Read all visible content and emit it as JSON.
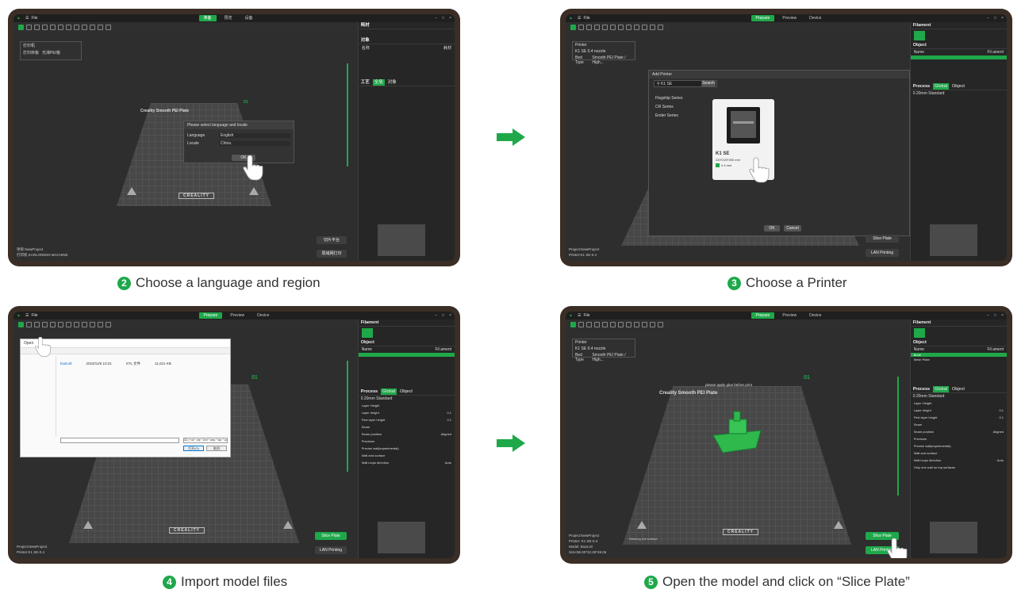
{
  "captions": {
    "step2": {
      "num": "2",
      "text": "Choose a language and region"
    },
    "step3": {
      "num": "3",
      "text": "Choose a Printer"
    },
    "step4": {
      "num": "4",
      "text": "Import model files"
    },
    "step5": {
      "num": "5",
      "text": "Open the model and click on “Slice Plate”"
    }
  },
  "colors": {
    "accent": "#1fa84a",
    "frame": "#3a2e26",
    "app_bg": "#2b2b2b"
  },
  "app": {
    "menu_file": "File",
    "tabs_en": [
      "Prepare",
      "Preview",
      "Device"
    ],
    "tabs_zh": [
      "准备",
      "预览",
      "设备"
    ],
    "plate_name": "Creality Smooth PEI Plate",
    "plate_warning": "please apply glue before print",
    "plate_number": "01",
    "brand": "CREALITY",
    "warning_surface": "Warning hot surface",
    "slice_plate": "Slice Plate",
    "lan_printing": "LAN Printing",
    "slice_zh": "切片平台",
    "lan_zh": "局域网打印"
  },
  "sidebar_en": {
    "filament": "Filament",
    "object": "Object",
    "process": "Process",
    "global": "Global",
    "object_tab": "Object",
    "preset": "0.20mm Standard",
    "col_name": "Name",
    "col_fil": "Fil ament",
    "model_item": "Bunk",
    "mesh_plate": "Mesh Plate",
    "rows": [
      {
        "label": "Layer Height",
        "value": ""
      },
      {
        "label": "Layer height",
        "value": "0.1"
      },
      {
        "label": "First layer height",
        "value": "0.1"
      },
      {
        "label": "Seam",
        "value": ""
      },
      {
        "label": "Seam position",
        "value": "Aligned"
      },
      {
        "label": "Precision",
        "value": ""
      },
      {
        "label": "Precise wall(experimental)",
        "value": ""
      },
      {
        "label": "Wall and surface",
        "value": ""
      },
      {
        "label": "Wall loops direction",
        "value": "Auto"
      },
      {
        "label": "Only one wall on top surfaces",
        "value": ""
      }
    ]
  },
  "sidebar_zh": {
    "filament": "耗材",
    "object": "对象",
    "process": "工艺",
    "global": "全局",
    "object_tab": "对象",
    "col_name": "名称",
    "col_fil": "耗材"
  },
  "step2": {
    "printer_label": "打印机",
    "bed_label": "打印床板",
    "bed_value": "光滑PEI板",
    "dialog_title": "Please select language and locale",
    "language_label": "Language",
    "language_value": "English",
    "locale_label": "Locale",
    "locale_value": "China",
    "ok": "OK",
    "project": "项目 NewProject",
    "printer": "打印机 KARLGREEN MACHINE"
  },
  "step3": {
    "printer_label": "Printer",
    "printer_value": "K1 SE 0.4 nozzle",
    "bed_label": "Bed Type",
    "bed_value": "Smooth PEI Plate / High...",
    "dialog_title": "Add Printer",
    "search_value": "K1 SE",
    "search_btn": "Search",
    "series": [
      "Flagship Series",
      "CR Series",
      "Ender Series"
    ],
    "card_name": "K1 SE",
    "card_size": "220*220*250 mm",
    "card_nozzle": "0.4 mm",
    "ok": "OK",
    "cancel": "Cancel",
    "project": "Project:NewProject",
    "printer": "Printer:K1 SE-0.4"
  },
  "step4": {
    "open_title": "Open",
    "file_name": "boat.stl",
    "file_date": "2023/11/6 10:21",
    "file_type": "STL 文件",
    "file_size": "11,021 KB",
    "filter": "3D (*.stl *.obj *.3mf *.step *.stp *.amf)",
    "open_btn": "打开(O)",
    "cancel_btn": "取消",
    "project": "Project:NewProject",
    "printer": "Printer:K1 SE-0.4"
  },
  "step5": {
    "project": "Project:NewProject",
    "printer": "Printer: K1 SE-0.4",
    "model": "Model: Boat.stl",
    "size": "Size:96.00*32.28*48.06"
  }
}
